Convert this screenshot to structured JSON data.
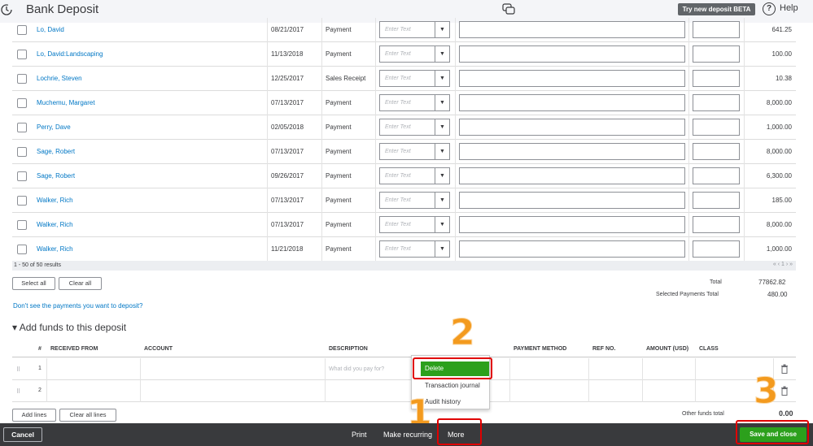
{
  "header": {
    "title": "Bank Deposit",
    "try_new": "Try new deposit BETA",
    "help": "Help"
  },
  "payments": {
    "placeholder": "Enter Text",
    "rows": [
      {
        "name": "Lo, David",
        "date": "08/21/2017",
        "type": "Payment",
        "amount": "641.25"
      },
      {
        "name": "Lo, David:Landscaping",
        "date": "11/13/2018",
        "type": "Payment",
        "amount": "100.00"
      },
      {
        "name": "Lochrie, Steven",
        "date": "12/25/2017",
        "type": "Sales Receipt",
        "amount": "10.38"
      },
      {
        "name": "Muchemu, Margaret",
        "date": "07/13/2017",
        "type": "Payment",
        "amount": "8,000.00"
      },
      {
        "name": "Perry, Dave",
        "date": "02/05/2018",
        "type": "Payment",
        "amount": "1,000.00"
      },
      {
        "name": "Sage, Robert",
        "date": "07/13/2017",
        "type": "Payment",
        "amount": "8,000.00"
      },
      {
        "name": "Sage, Robert",
        "date": "09/26/2017",
        "type": "Payment",
        "amount": "6,300.00"
      },
      {
        "name": "Walker, Rich",
        "date": "07/13/2017",
        "type": "Payment",
        "amount": "185.00"
      },
      {
        "name": "Walker, Rich",
        "date": "07/13/2017",
        "type": "Payment",
        "amount": "8,000.00"
      },
      {
        "name": "Walker, Rich",
        "date": "11/21/2018",
        "type": "Payment",
        "amount": "1,000.00"
      }
    ],
    "results": "1 - 50 of 50 results",
    "pager": "« ‹ 1 › »",
    "select_all": "Select all",
    "clear_all": "Clear all",
    "total_label": "Total",
    "total_value": "77862.82",
    "selected_label": "Selected Payments Total",
    "selected_value": "480.00",
    "missing_link": "Don't see the payments you want to deposit?"
  },
  "funds": {
    "section_title": "▾ Add funds to this deposit",
    "headers": {
      "num": "#",
      "received_from": "RECEIVED FROM",
      "account": "ACCOUNT",
      "description": "DESCRIPTION",
      "payment_method": "PAYMENT METHOD",
      "ref_no": "REF NO.",
      "amount": "AMOUNT (USD)",
      "class": "CLASS"
    },
    "rows": [
      {
        "num": "1",
        "description_placeholder": "What did you pay for?"
      },
      {
        "num": "2",
        "description_placeholder": ""
      }
    ],
    "add_lines": "Add lines",
    "clear_all_lines": "Clear all lines",
    "other_total_label": "Other funds total",
    "other_total_value": "0.00"
  },
  "more_menu": {
    "items": [
      "Delete",
      "Transaction journal",
      "Audit history"
    ]
  },
  "annotations": {
    "step1": "1",
    "step2": "2",
    "step3": "3",
    "color": "#f39a1e"
  },
  "footer": {
    "cancel": "Cancel",
    "print": "Print",
    "make_recurring": "Make recurring",
    "more": "More",
    "save_close": "Save and close"
  },
  "colors": {
    "accent_green": "#2ca01c",
    "link_blue": "#0077c5",
    "footer_bg": "#393a3d",
    "highlight_red": "#e00000"
  }
}
